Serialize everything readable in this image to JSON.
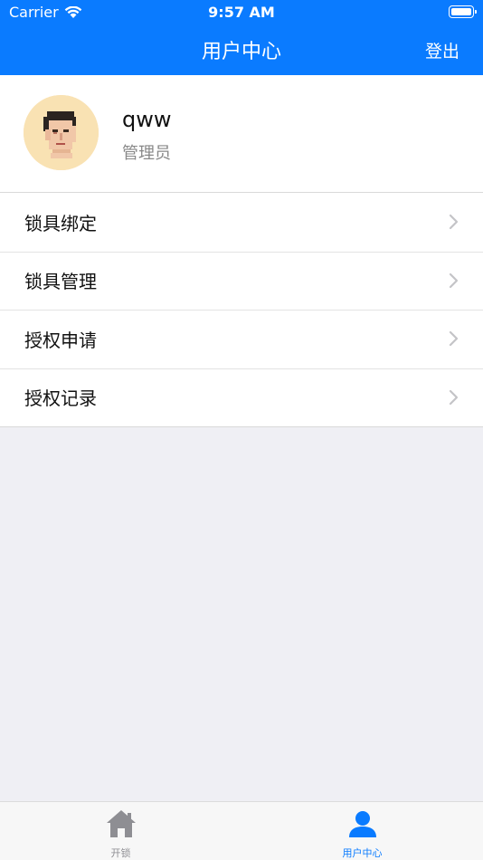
{
  "status_bar": {
    "carrier": "Carrier",
    "time": "9:57 AM"
  },
  "nav": {
    "title": "用户中心",
    "logout_label": "登出"
  },
  "profile": {
    "username": "qww",
    "role": "管理员"
  },
  "menu": {
    "items": [
      {
        "label": "锁具绑定",
        "icon": "chevron-right-icon"
      },
      {
        "label": "锁具管理",
        "icon": "chevron-right-icon"
      },
      {
        "label": "授权申请",
        "icon": "chevron-right-icon"
      },
      {
        "label": "授权记录",
        "icon": "chevron-right-icon"
      }
    ]
  },
  "tabbar": {
    "tabs": [
      {
        "label": "开锁",
        "icon": "home-icon",
        "active": false
      },
      {
        "label": "用户中心",
        "icon": "user-icon",
        "active": true
      }
    ]
  },
  "colors": {
    "brand": "#0a7bff",
    "tab_inactive": "#8e8e93",
    "page_bg": "#efeff4"
  }
}
